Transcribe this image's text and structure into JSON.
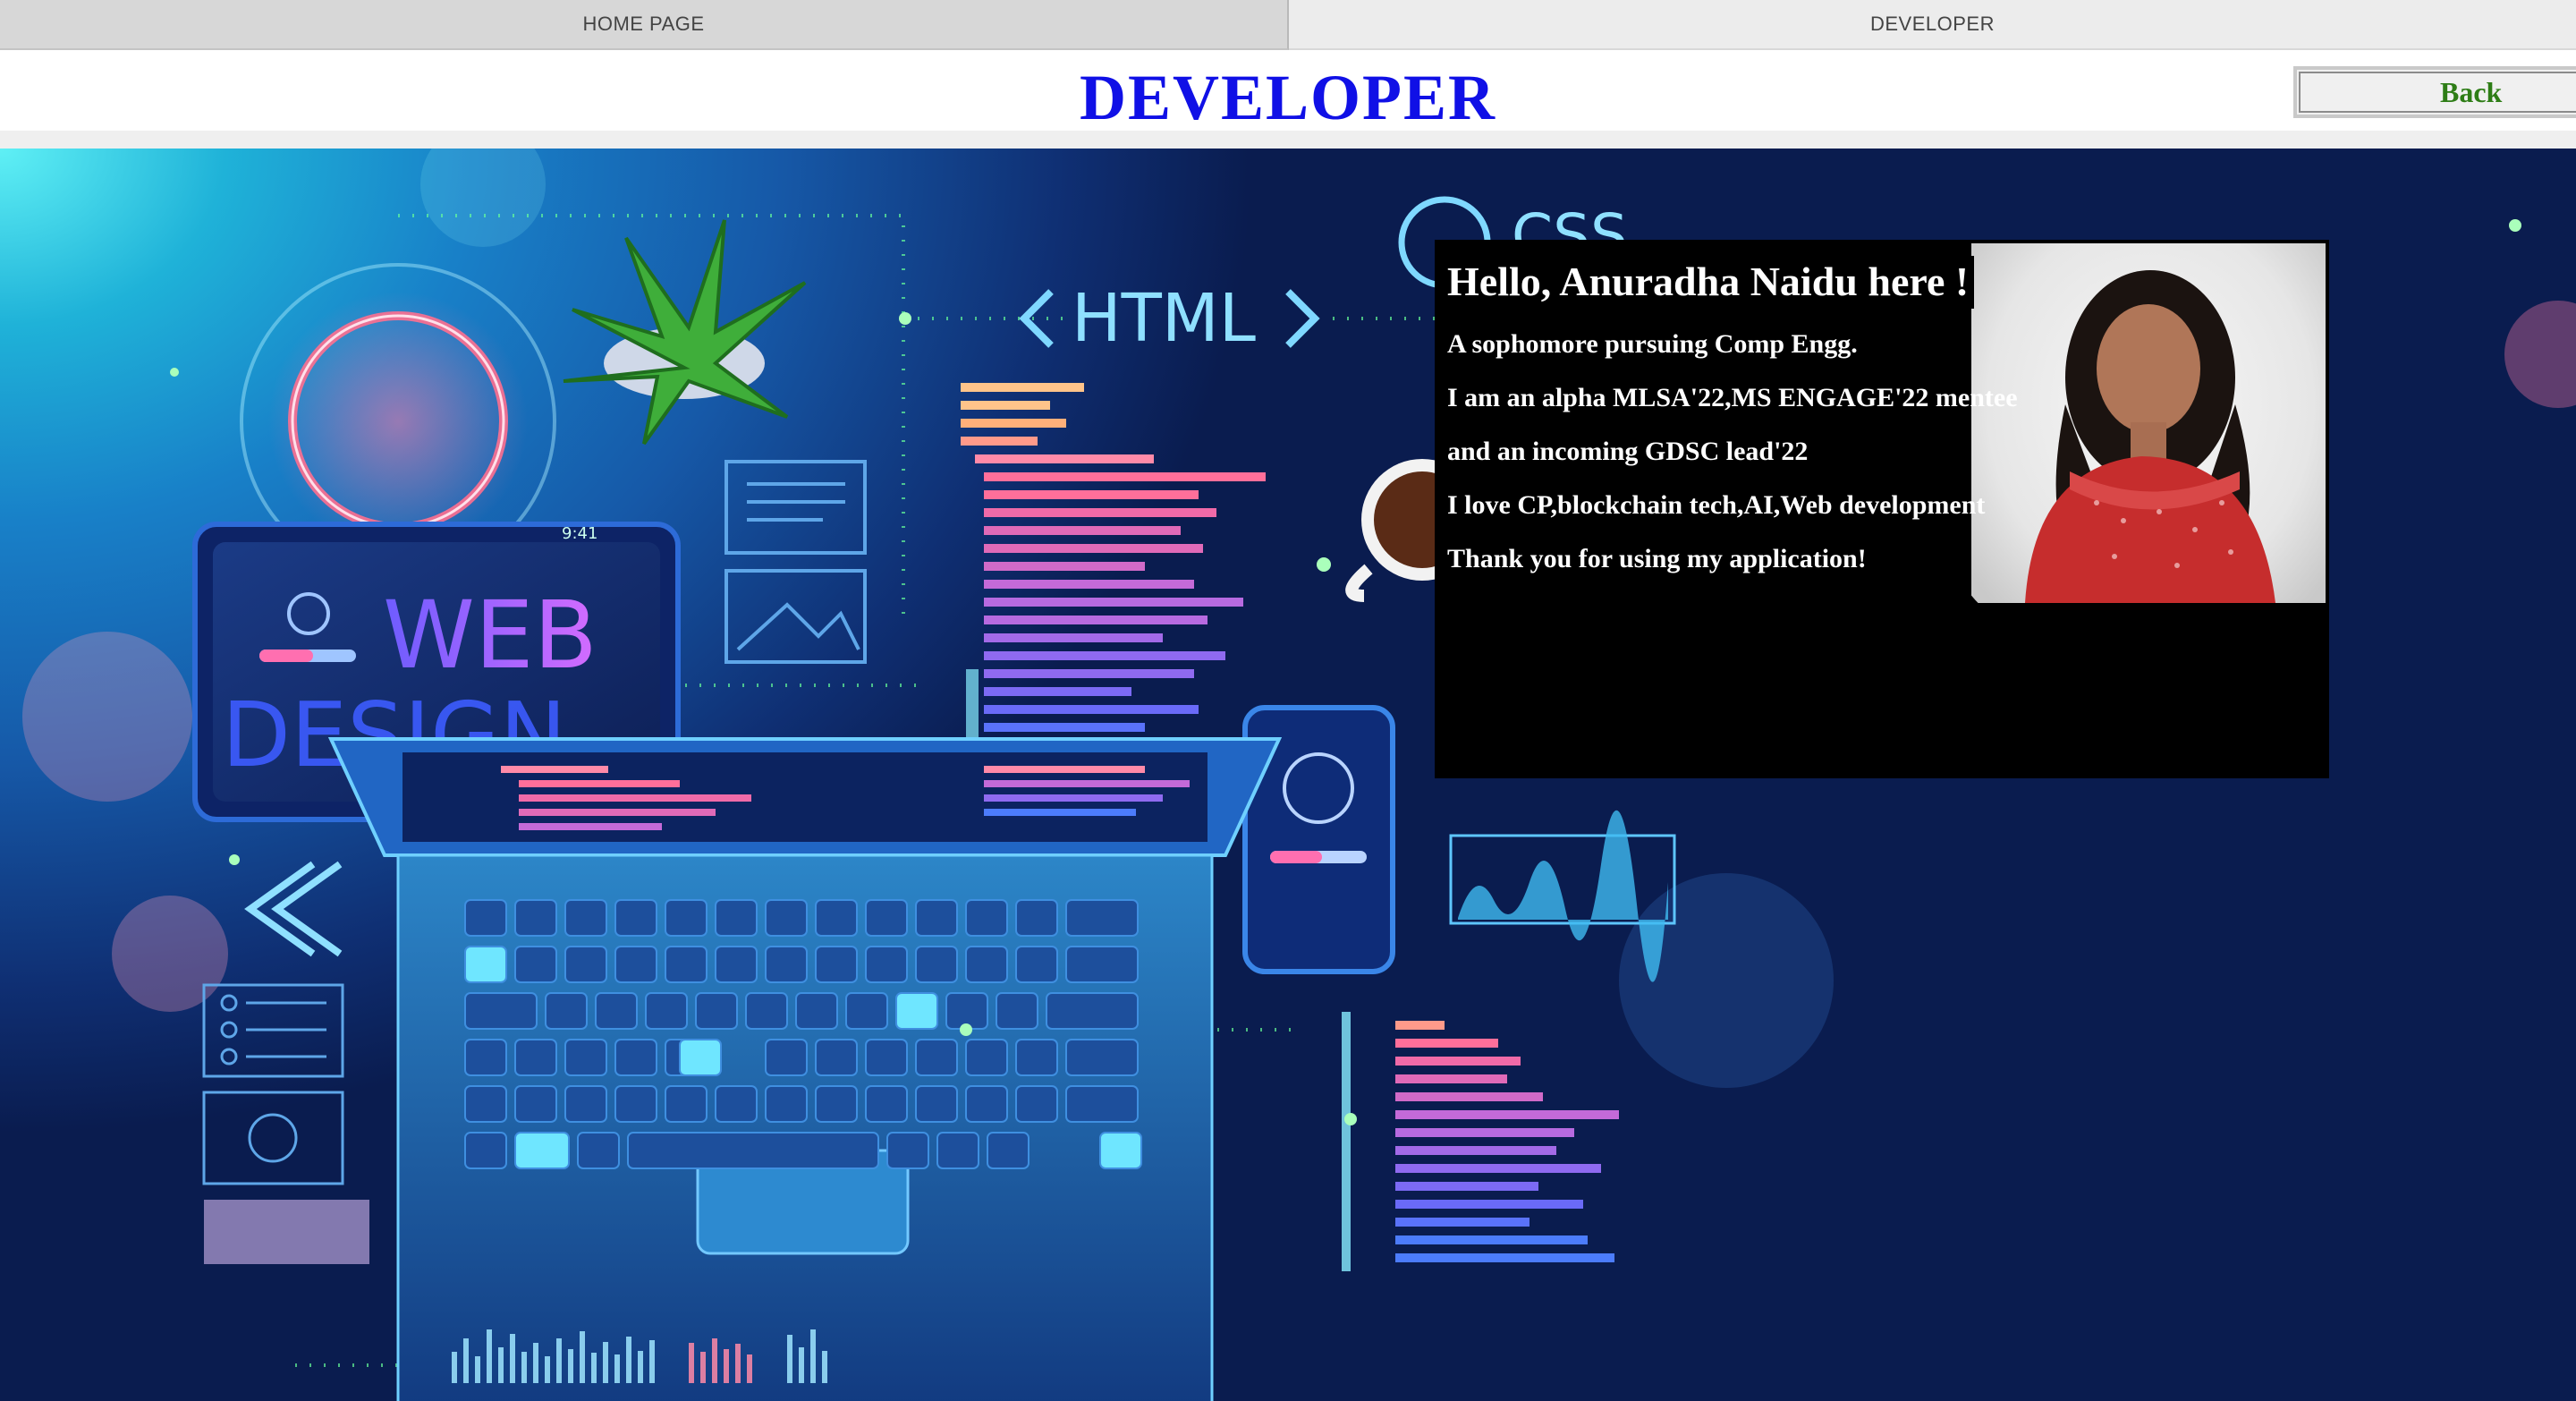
{
  "tabs": [
    {
      "label": "HOME PAGE",
      "active": false
    },
    {
      "label": "DEVELOPER",
      "active": true
    }
  ],
  "header": {
    "title": "DEVELOPER",
    "back_label": "Back"
  },
  "hero": {
    "labels": {
      "html": "HTML",
      "css": "CSS",
      "web": "WEB",
      "design": "DESIGN",
      "time": "9:41"
    }
  },
  "card": {
    "heading": "Hello, Anuradha Naidu here !",
    "lines": [
      "A sophomore pursuing Comp Engg.",
      "I am an alpha MLSA'22,MS ENGAGE'22 mentee",
      "and an incoming GDSC lead'22",
      "I love CP,blockchain tech,AI,Web development",
      "Thank you for using my application!"
    ]
  },
  "colors": {
    "title": "#1010e6",
    "back_text": "#2e7d16",
    "card_bg": "#000000",
    "card_text": "#ffffff"
  }
}
